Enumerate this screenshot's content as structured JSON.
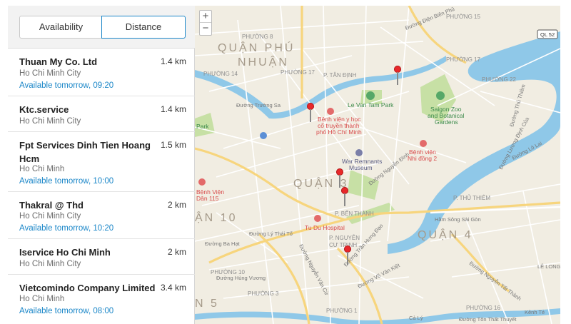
{
  "sort_tabs": {
    "availability": "Availability",
    "distance": "Distance",
    "selected": "distance"
  },
  "stores": [
    {
      "name": "Thuan My Co. Ltd",
      "distance": "1.4 km",
      "city": "Ho Chi Minh City",
      "availability": "Available tomorrow, 09:20"
    },
    {
      "name": "Ktc.service",
      "distance": "1.4 km",
      "city": "Ho Chi Minh City",
      "availability": ""
    },
    {
      "name": "Fpt Services Dinh Tien Hoang Hcm",
      "distance": "1.5 km",
      "city": "Ho Chi Minh",
      "availability": "Available tomorrow, 10:00"
    },
    {
      "name": "Thakral @ Thd",
      "distance": "2 km",
      "city": "Ho Chi Minh City",
      "availability": "Available tomorrow, 10:20"
    },
    {
      "name": "Iservice Ho Chi Minh",
      "distance": "2 km",
      "city": "Ho Chi Minh City",
      "availability": ""
    },
    {
      "name": "Vietcomindo Company Limited",
      "distance": "3.4 km",
      "city": "Ho Chi Minh",
      "availability": "Available tomorrow, 08:00"
    }
  ],
  "map": {
    "zoom_in": "+",
    "zoom_out": "−",
    "districts": {
      "phu_nhuan_1": "QUẬN PHÚ",
      "phu_nhuan_2": "NHUẬN",
      "q3": "QUẬN 3",
      "q10": "ẬN 10",
      "q4": "QUẬN 4",
      "q5": "N 5"
    },
    "wards": {
      "p8": "PHƯỜNG 8",
      "p14": "PHƯỜNG 14",
      "p17a": "PHƯỜNG 17",
      "p17b": "PHƯỜNG 17",
      "p22": "PHƯỜNG 22",
      "p15": "PHƯỜNG 15",
      "p10": "PHƯỜNG 10",
      "p3": "PHƯỜNG 3",
      "p1": "PHƯỜNG 1",
      "p16": "PHƯỜNG 16",
      "p_tan_dinh": "P. TÂN ĐỊNH",
      "p_ben_thanh": "P. BẾN THÀNH",
      "p_ng_cu_trinh_1": "P. NGUYỄN",
      "p_ng_cu_trinh_2": "CƯ TRINH",
      "p_thu_thiem": "P. THỦ THIÊM"
    },
    "places": {
      "le_van_tam": "Le Van Tam Park",
      "zoo_1": "Saigon Zoo",
      "zoo_2": "and Botanical",
      "zoo_3": "Gardens",
      "hospital_1": "Bệnh viện y học",
      "hospital_2": "cổ truyền thành",
      "hospital_3": "phố Hồ Chí Minh",
      "war_1": "War Remnants",
      "war_2": "Museum",
      "nhi_dong_1": "Bệnh viện",
      "nhi_dong_2": "Nhi đồng 2",
      "tu_du": "Tu Du Hospital",
      "benh_vien_115_1": "Bệnh Viện",
      "benh_vien_115_2": "Dân 115",
      "park": "Park"
    },
    "roads": {
      "ly_thai_to": "Đường Lý Thái Tổ",
      "ba_hat": "Đường Ba Hạt",
      "hung_vuong": "Đường Hùng Vương",
      "nguyen_van_cu": "Đường Nguyễn Văn Cừ",
      "truong_sa": "Đường Trường Sa",
      "ham_song_sai_gon": "Hầm Sông Sài Gòn",
      "nguyen_tat_thanh": "Đường Nguyễn Tất Thành",
      "ton_that_thuyet": "Đường Tôn Thất Thuyết",
      "dien_bien_phu": "Đường Điện Biên Phủ",
      "tran_hung_dao": "Đường Trần Hưng Đạo",
      "vo_van_kiet": "Đường Võ Văn Kiệt",
      "nguyen_dinh_chieu": "Đường Nguyễn Đình",
      "luong_dinh_cua": "Đường Lương Định Của",
      "thu_thiem": "Đường Thủ Thiêm",
      "lo_lai": "Đường Lô Lai",
      "cai_lu": "Cả Lý",
      "kenh_te": "Kênh Tẻ",
      "ql52": "QL 52",
      "le_long": "LÊ LONG"
    }
  },
  "colors": {
    "accent": "#1a86c8",
    "pin": "#e8282a",
    "water": "#8fc8e8",
    "park": "#c7e0a5",
    "land": "#f1ede2",
    "road": "#ffffff",
    "major_road": "#f7d57d"
  }
}
